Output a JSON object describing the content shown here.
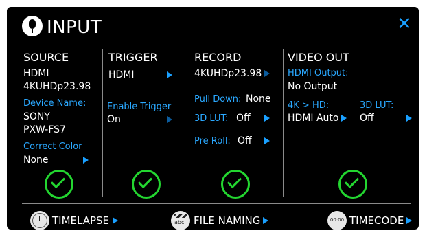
{
  "header": {
    "title": "INPUT",
    "close_label": "✕"
  },
  "source": {
    "heading": "SOURCE",
    "interface": "HDMI",
    "format": "4KUHDp23.98",
    "device_name_label": "Device Name:",
    "device_make": "SONY",
    "device_model": "PXW-FS7",
    "correct_color_label": "Correct Color",
    "correct_color_value": "None"
  },
  "trigger": {
    "heading": "TRIGGER",
    "source_value": "HDMI",
    "enable_label": "Enable Trigger",
    "enable_value": "On"
  },
  "record": {
    "heading": "RECORD",
    "format": "4KUHDp23.98",
    "pulldown_label": "Pull Down:",
    "pulldown_value": "None",
    "lut_label": "3D LUT:",
    "lut_value": "Off",
    "preroll_label": "Pre Roll:",
    "preroll_value": "Off"
  },
  "video_out": {
    "heading": "VIDEO OUT",
    "hdmi_output_label": "HDMI Output:",
    "hdmi_output_value": "No Output",
    "downconvert_label": "4K > HD:",
    "downconvert_value": "HDMI Auto",
    "lut_label": "3D LUT:",
    "lut_value": "Off"
  },
  "footer": {
    "timelapse_label": "TIMELAPSE",
    "file_naming_label": "FILE NAMING",
    "file_naming_icon_text": "abc",
    "timecode_label": "TIMECODE",
    "timecode_icon_text": "00:00"
  },
  "colors": {
    "accent": "#1aa0ff",
    "ok": "#23d630",
    "background": "#000000"
  }
}
